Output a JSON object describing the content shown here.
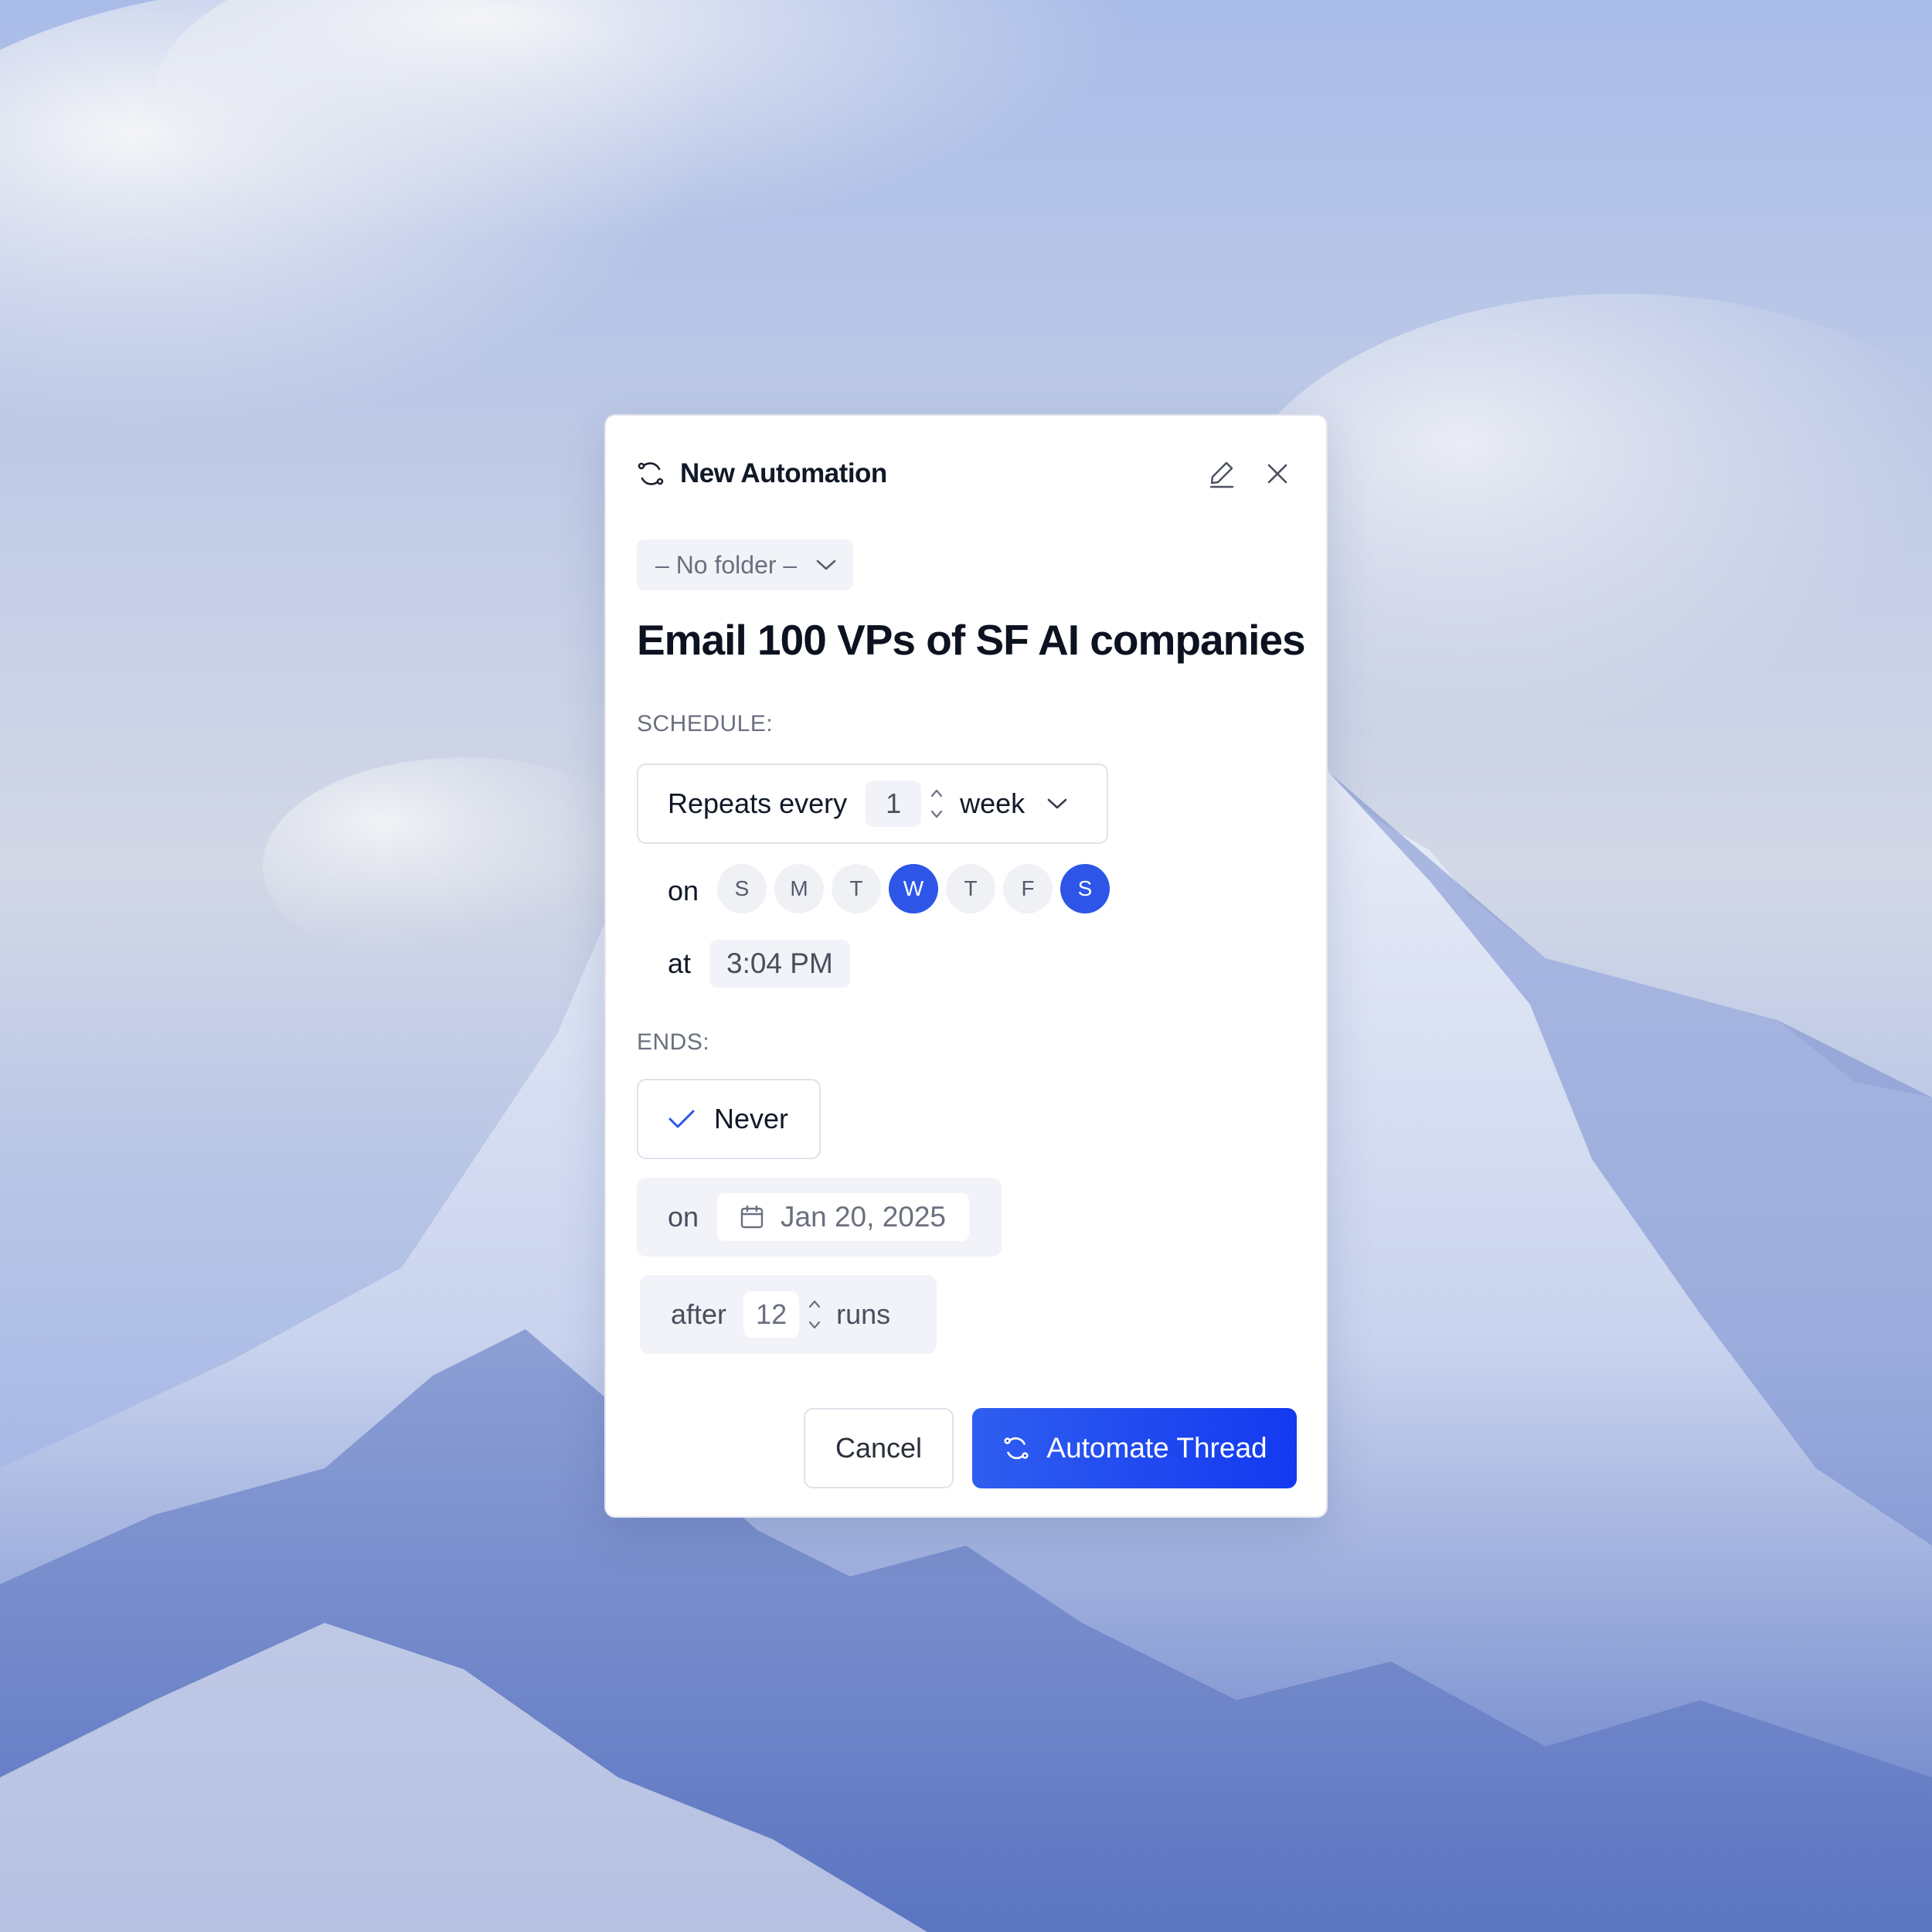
{
  "dialog": {
    "title": "New Automation",
    "header_icon": "refresh-icon",
    "edit_icon": "pencil-icon",
    "close_icon": "close-icon"
  },
  "folder": {
    "selected": "– No folder –"
  },
  "automation": {
    "title": "Email 100 VPs of SF AI companies"
  },
  "schedule": {
    "label": "SCHEDULE:",
    "repeats_label": "Repeats every",
    "interval": "1",
    "unit": "week",
    "on_label": "on",
    "days": [
      {
        "label": "S",
        "selected": false
      },
      {
        "label": "M",
        "selected": false
      },
      {
        "label": "T",
        "selected": false
      },
      {
        "label": "W",
        "selected": true
      },
      {
        "label": "T",
        "selected": false
      },
      {
        "label": "F",
        "selected": false
      },
      {
        "label": "S",
        "selected": true
      }
    ],
    "at_label": "at",
    "time": "3:04 PM"
  },
  "ends": {
    "label": "ENDS:",
    "never_label": "Never",
    "on_label": "on",
    "date": "Jan 20, 2025",
    "after_label": "after",
    "runs_count": "12",
    "runs_label": "runs",
    "selected": "never"
  },
  "actions": {
    "cancel_label": "Cancel",
    "primary_label": "Automate Thread"
  },
  "colors": {
    "accent": "#2d56e8",
    "primary_button": "#1f47f0"
  }
}
